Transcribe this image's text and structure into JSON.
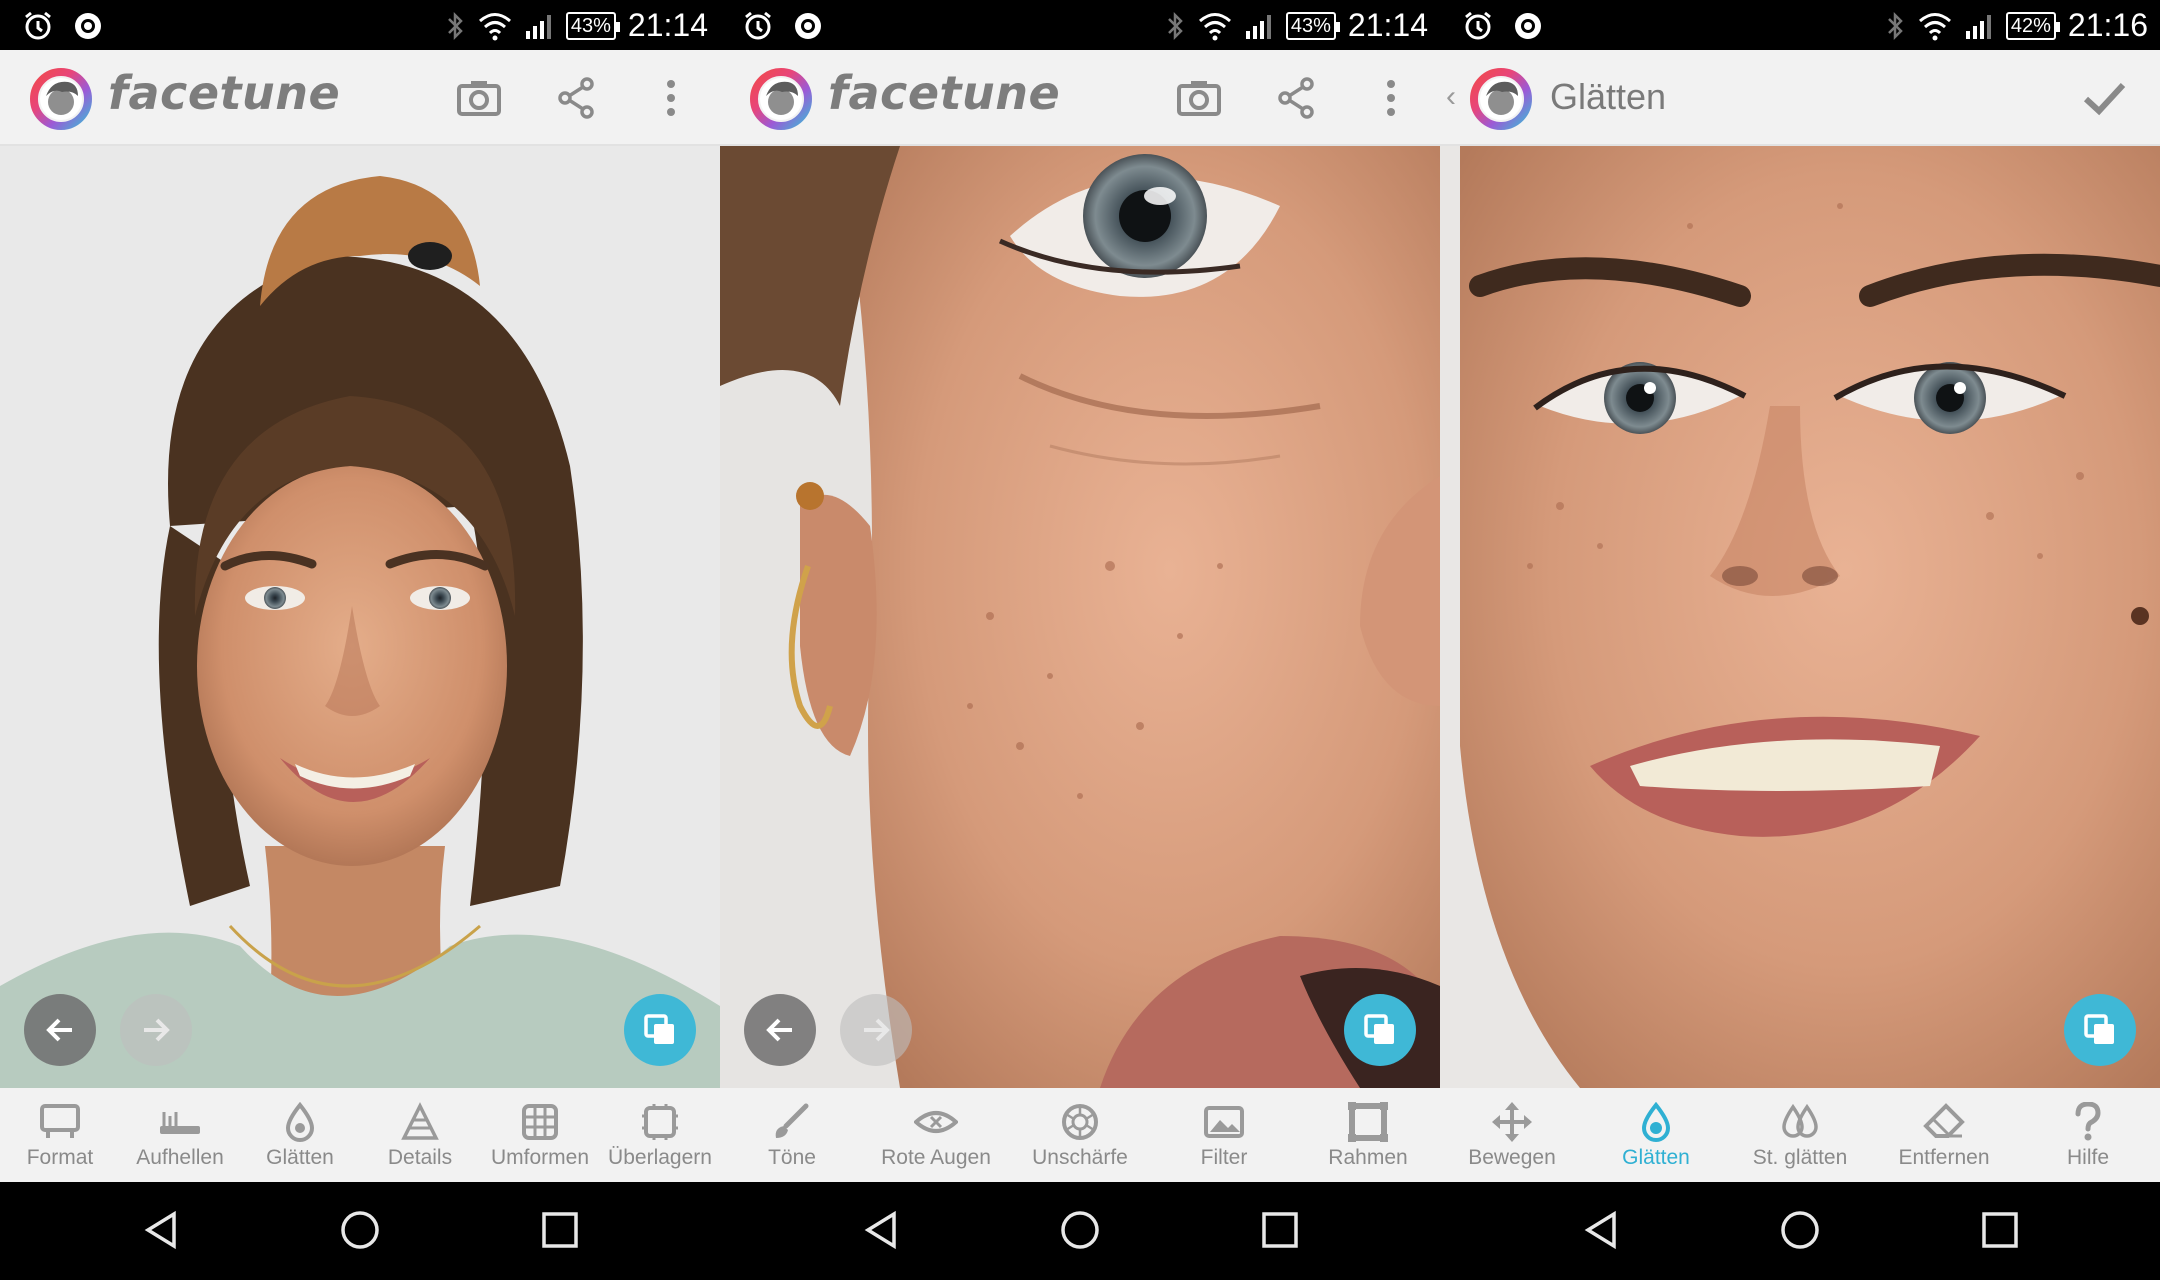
{
  "colors": {
    "accent": "#3fb8d6",
    "active_label": "#2fb0d3",
    "label": "#8a8a8a",
    "bar_bg": "#f2f2f2"
  },
  "screens": [
    {
      "status": {
        "battery": "43%",
        "time": "21:14"
      },
      "app_bar": {
        "brand": "facetune",
        "icons": [
          "camera-icon",
          "share-icon",
          "overflow-menu-icon"
        ]
      },
      "toolbar": [
        "Format",
        "Aufhellen",
        "Glätten",
        "Details",
        "Umformen",
        "Überlagern"
      ]
    },
    {
      "status": {
        "battery": "43%",
        "time": "21:14"
      },
      "app_bar": {
        "brand": "facetune",
        "icons": [
          "camera-icon",
          "share-icon",
          "overflow-menu-icon"
        ]
      },
      "toolbar": [
        "Töne",
        "Rote Augen",
        "Unschärfe",
        "Filter",
        "Rahmen"
      ]
    },
    {
      "status": {
        "battery": "42%",
        "time": "21:16"
      },
      "app_bar": {
        "title": "Glätten",
        "back": "‹",
        "icons": [
          "checkmark-icon"
        ]
      },
      "toolbar": [
        "Bewegen",
        "Glätten",
        "St. glätten",
        "Entfernen",
        "Hilfe"
      ],
      "active_tool": "Glätten"
    }
  ]
}
